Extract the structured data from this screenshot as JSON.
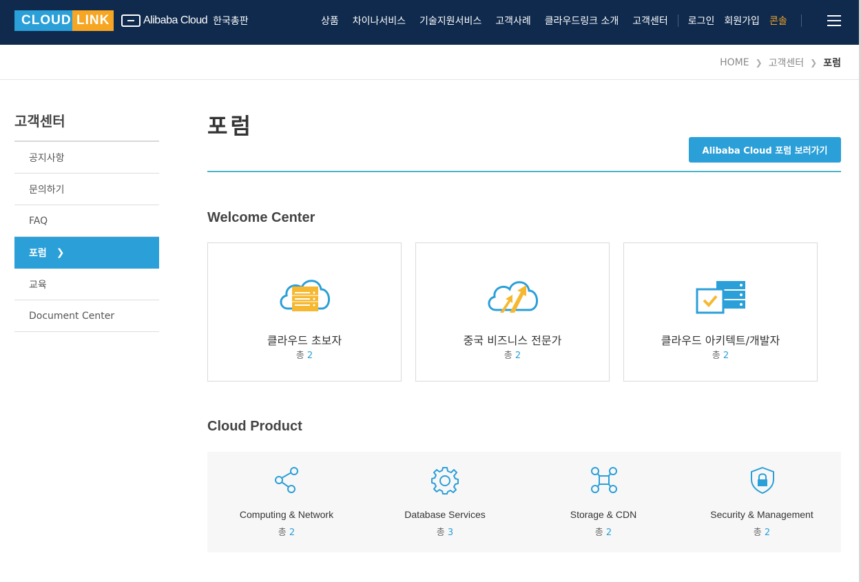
{
  "header": {
    "logo_cloud": "CLOUD",
    "logo_link": "LINK",
    "partner_brand": "Alibaba Cloud",
    "partner_region": "한국총판",
    "nav": [
      "상품",
      "차이나서비스",
      "기술지원서비스",
      "고객사례",
      "클라우드링크 소개",
      "고객센터"
    ],
    "login": "로그인",
    "signup": "회원가입",
    "console": "콘솔",
    "colors": {
      "bg": "#0f2a4d",
      "accent": "#f6a623",
      "brand_blue": "#2a9fd8"
    }
  },
  "breadcrumb": {
    "home": "HOME",
    "section": "고객센터",
    "current": "포럼"
  },
  "sidebar": {
    "title": "고객센터",
    "items": [
      {
        "label": "공지사항",
        "active": false
      },
      {
        "label": "문의하기",
        "active": false
      },
      {
        "label": "FAQ",
        "active": false
      },
      {
        "label": "포럼",
        "active": true
      },
      {
        "label": "교육",
        "active": false
      },
      {
        "label": "Document Center",
        "active": false
      }
    ]
  },
  "main": {
    "title": "포럼",
    "forum_button": "Alibaba Cloud 포럼 보러가기",
    "welcome": {
      "title": "Welcome Center",
      "cards": [
        {
          "name": "클라우드 초보자",
          "count_prefix": "총",
          "count": "2",
          "icon": "cloud-server-icon"
        },
        {
          "name": "중국 비즈니스 전문가",
          "count_prefix": "총",
          "count": "2",
          "icon": "cloud-growth-icon"
        },
        {
          "name": "클라우드 아키텍트/개발자",
          "count_prefix": "총",
          "count": "2",
          "icon": "server-check-icon"
        }
      ]
    },
    "products": {
      "title": "Cloud Product",
      "items": [
        {
          "name": "Computing & Network",
          "count_prefix": "총",
          "count": "2",
          "icon": "share-network-icon"
        },
        {
          "name": "Database Services",
          "count_prefix": "총",
          "count": "3",
          "icon": "gear-icon"
        },
        {
          "name": "Storage & CDN",
          "count_prefix": "총",
          "count": "2",
          "icon": "node-cluster-icon"
        },
        {
          "name": "Security & Management",
          "count_prefix": "총",
          "count": "2",
          "icon": "shield-lock-icon"
        }
      ]
    }
  }
}
